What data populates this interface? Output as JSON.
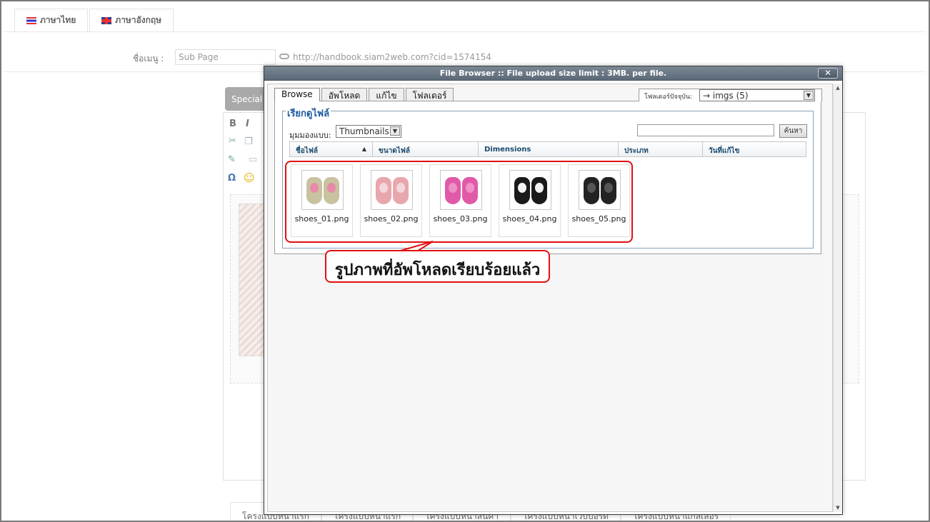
{
  "page": {
    "lang_tabs": [
      "ภาษาไทย",
      "ภาษาอังกฤษ"
    ],
    "menu_label": "ชื่อเมนู :",
    "menu_value": "Sub Page",
    "page_url": "http://handbook.siam2web.com?cid=1574154",
    "special_label": "Special",
    "bottom_tabs": [
      "โครงแบบหน้าแรก",
      "โครงแบบหน้าแรก",
      "โครงแบบหน้าสินค้า",
      "โครงแบบหน้าเว็บบอร์ด",
      "โครงแบบหน้าแกลเลอรี่"
    ]
  },
  "dialog": {
    "title": "File Browser :: File upload size limit : 3MB. per file.",
    "close_label": "✕",
    "tabs": [
      "Browse",
      "อัพโหลด",
      "แก้ไข",
      "โฟลเดอร์"
    ],
    "current_folder_label": "โฟลเดอร์ปัจจุบัน:",
    "current_folder_value": "→ imgs (5)",
    "legend": "เรียกดูไฟล์",
    "view_label": "มุมมองแบบ:",
    "view_value": "Thumbnails",
    "search_button": "ค้นหา",
    "columns": [
      "ชื่อไฟล์",
      "ขนาดไฟล์",
      "Dimensions",
      "ประเภท",
      "วันที่แก้ไข"
    ],
    "sort_indicator": "▲",
    "files": [
      {
        "name": "shoes_01.png",
        "color": "#c9c2a0",
        "accent": "#e98aa8"
      },
      {
        "name": "shoes_02.png",
        "color": "#e8a6ad",
        "accent": "#f3d7db"
      },
      {
        "name": "shoes_03.png",
        "color": "#e05aa8",
        "accent": "#f090c8"
      },
      {
        "name": "shoes_04.png",
        "color": "#1a1a1a",
        "accent": "#f2f2f2"
      },
      {
        "name": "shoes_05.png",
        "color": "#222222",
        "accent": "#555555"
      }
    ]
  },
  "annotation": {
    "callout": "รูปภาพที่อัพโหลดเรียบร้อยแล้ว",
    "color": "#e01010"
  }
}
